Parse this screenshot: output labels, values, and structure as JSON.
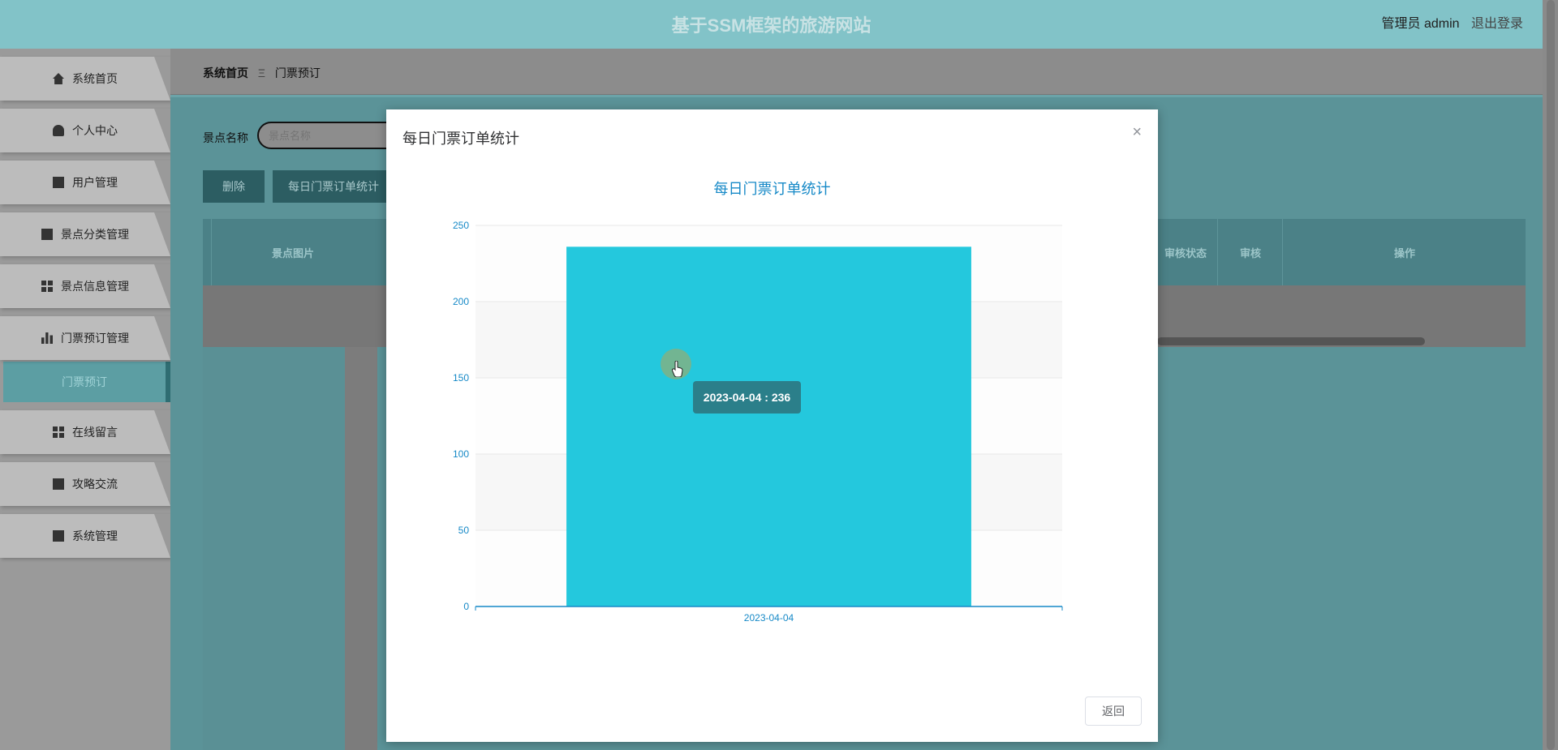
{
  "header": {
    "site_title": "基于SSM框架的旅游网站",
    "user_label": "管理员 admin",
    "logout_label": "退出登录"
  },
  "sidebar": {
    "items": [
      {
        "label": "系统首页",
        "icon": "home-icon"
      },
      {
        "label": "个人中心",
        "icon": "user-icon"
      },
      {
        "label": "用户管理",
        "icon": "users-icon"
      },
      {
        "label": "景点分类管理",
        "icon": "briefcase-icon"
      },
      {
        "label": "景点信息管理",
        "icon": "grid-icon"
      },
      {
        "label": "门票预订管理",
        "icon": "bar-chart-icon"
      }
    ],
    "active_sub": "门票预订",
    "items_after": [
      {
        "label": "在线留言",
        "icon": "grid-icon"
      },
      {
        "label": "攻略交流",
        "icon": "clipboard-icon"
      },
      {
        "label": "系统管理",
        "icon": "clipboard-x-icon"
      }
    ]
  },
  "breadcrumb": {
    "home": "系统首页",
    "separator": "Ξ",
    "current": "门票预订"
  },
  "search": {
    "label": "景点名称",
    "placeholder": "景点名称"
  },
  "buttons": {
    "delete": "删除",
    "daily_stats": "每日门票订单统计"
  },
  "table": {
    "headers": [
      "景点图片",
      "审核状态",
      "审核",
      "操作"
    ]
  },
  "dialog": {
    "title": "每日门票订单统计",
    "close_icon": "close-icon",
    "return_label": "返回",
    "tooltip": "2023-04-04 : 236"
  },
  "chart_data": {
    "type": "bar",
    "title": "每日门票订单统计",
    "categories": [
      "2023-04-04"
    ],
    "values": [
      236
    ],
    "ylim": [
      0,
      250
    ],
    "yticks": [
      0,
      50,
      100,
      150,
      200,
      250
    ],
    "bar_color": "#24c8dd",
    "axis_color": "#1689c7",
    "grid": true
  }
}
